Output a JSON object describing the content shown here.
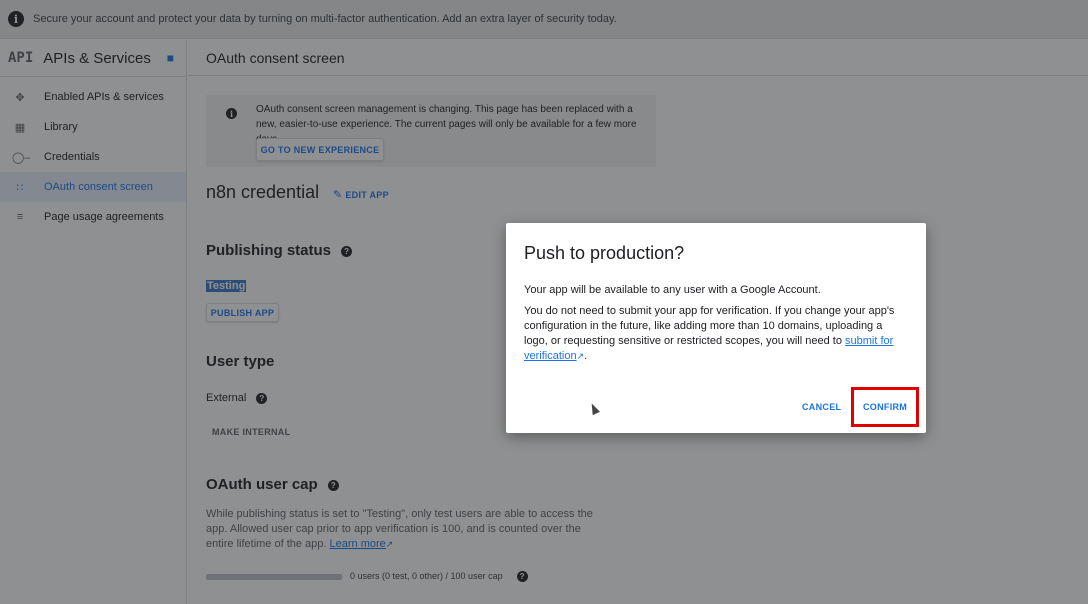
{
  "banner": {
    "text": "Secure your account and protect your data by turning on multi-factor authentication. Add an extra layer of security today."
  },
  "sidebar": {
    "logo": "API",
    "title": "APIs & Services",
    "items": [
      {
        "icon": "diamond-icon",
        "label": "Enabled APIs & services"
      },
      {
        "icon": "grid-icon",
        "label": "Library"
      },
      {
        "icon": "key-icon",
        "label": "Credentials"
      },
      {
        "icon": "consent-icon",
        "label": "OAuth consent screen",
        "active": true
      },
      {
        "icon": "settings-list-icon",
        "label": "Page usage agreements"
      }
    ]
  },
  "header": {
    "title": "OAuth consent screen"
  },
  "notice": {
    "text": "OAuth consent screen management is changing. This page has been replaced with a new, easier-to-use experience. The current pages will only be available for a few more days.",
    "button": "GO TO NEW EXPERIENCE"
  },
  "app": {
    "name": "n8n credential",
    "edit_label": "EDIT APP"
  },
  "publishing": {
    "heading": "Publishing status",
    "status": "Testing",
    "button": "PUBLISH APP"
  },
  "user_type": {
    "heading": "User type",
    "value": "External",
    "button": "MAKE INTERNAL"
  },
  "user_cap": {
    "heading": "OAuth user cap",
    "text": "While publishing status is set to \"Testing\", only test users are able to access the app. Allowed user cap prior to app verification is 100, and is counted over the entire lifetime of the app.",
    "link": "Learn more",
    "usage": "0 users (0 test, 0 other) / 100 user cap"
  },
  "dialog": {
    "title": "Push to production?",
    "p1": "Your app will be available to any user with a Google Account.",
    "p2": "You do not need to submit your app for verification. If you change your app's configuration in the future, like adding more than 10 domains, uploading a logo, or requesting sensitive or restricted scopes, you will need to",
    "link": "submit for verification",
    "cancel": "CANCEL",
    "confirm": "CONFIRM"
  },
  "colors": {
    "accent": "#1a73e8",
    "highlight_box": "#e00000"
  }
}
